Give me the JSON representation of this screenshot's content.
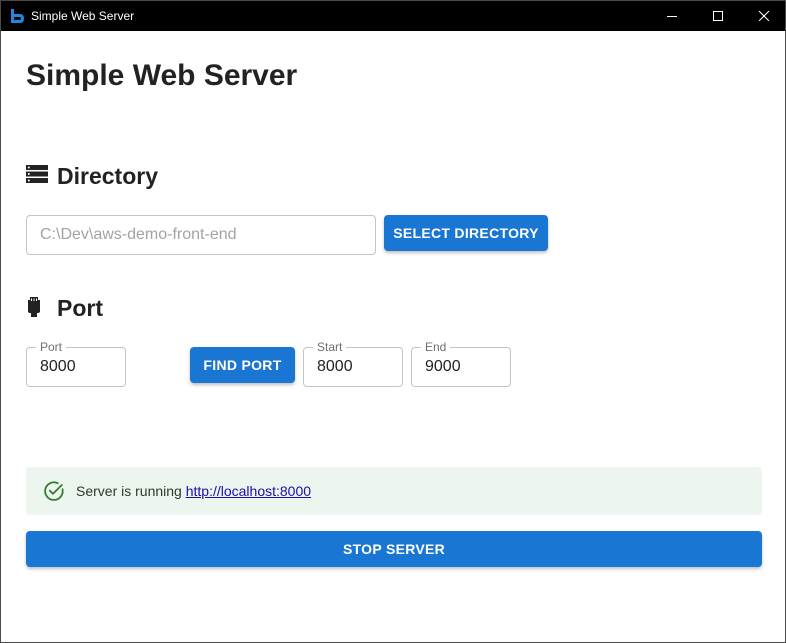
{
  "window": {
    "title": "Simple Web Server",
    "controls": {
      "minimize": "minimize-icon",
      "maximize": "maximize-icon",
      "close": "close-icon"
    }
  },
  "page": {
    "title": "Simple Web Server"
  },
  "directory": {
    "heading": "Directory",
    "icon": "server-stack-icon",
    "path_value": "C:\\Dev\\aws-demo-front-end",
    "select_label": "SELECT DIRECTORY"
  },
  "port": {
    "heading": "Port",
    "icon": "ethernet-plug-icon",
    "port_label": "Port",
    "port_value": "8000",
    "find_label": "FIND PORT",
    "start_label": "Start",
    "start_value": "8000",
    "end_label": "End",
    "end_value": "9000"
  },
  "status": {
    "icon": "check-circle-icon",
    "text": "Server is running",
    "link": "http://localhost:8000"
  },
  "stop_label": "STOP SERVER",
  "colors": {
    "primary": "#1976d2",
    "success_bg": "#edf6ee",
    "success_icon": "#2e7d32",
    "titlebar": "#000000"
  }
}
